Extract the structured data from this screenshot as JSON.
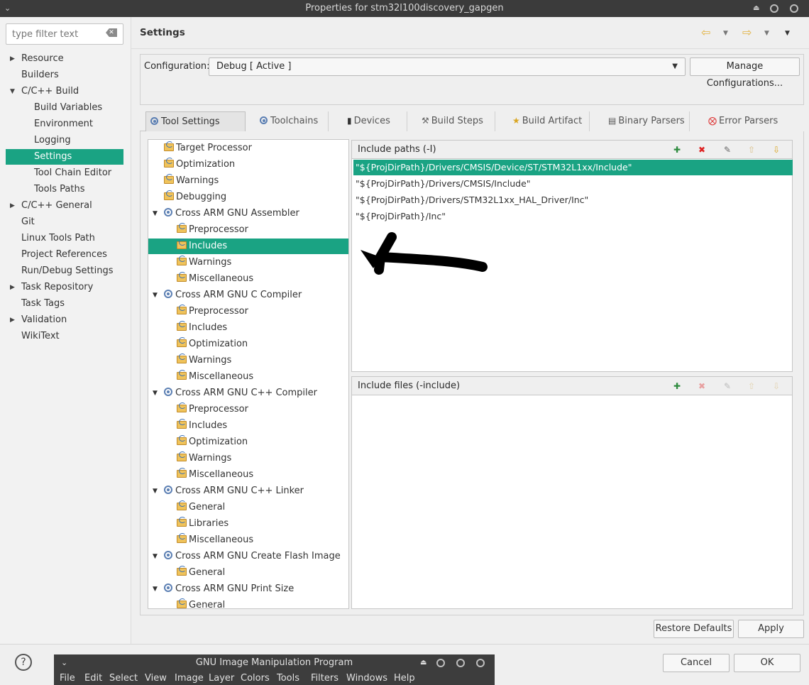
{
  "window": {
    "title": "Properties for stm32l100discovery_gapgen"
  },
  "sidebar": {
    "filter_placeholder": "type filter text",
    "items": [
      {
        "label": "Resource",
        "expander": "collapsed"
      },
      {
        "label": "Builders"
      },
      {
        "label": "C/C++ Build",
        "expander": "expanded"
      },
      {
        "label": "Build Variables",
        "indent": true
      },
      {
        "label": "Environment",
        "indent": true
      },
      {
        "label": "Logging",
        "indent": true
      },
      {
        "label": "Settings",
        "indent": true,
        "selected": true
      },
      {
        "label": "Tool Chain Editor",
        "indent": true
      },
      {
        "label": "Tools Paths",
        "indent": true
      },
      {
        "label": "C/C++ General",
        "expander": "collapsed"
      },
      {
        "label": "Git"
      },
      {
        "label": "Linux Tools Path"
      },
      {
        "label": "Project References"
      },
      {
        "label": "Run/Debug Settings"
      },
      {
        "label": "Task Repository",
        "expander": "collapsed"
      },
      {
        "label": "Task Tags"
      },
      {
        "label": "Validation",
        "expander": "collapsed"
      },
      {
        "label": "WikiText"
      }
    ]
  },
  "header": {
    "title": "Settings"
  },
  "config": {
    "label": "Configuration:",
    "value": "Debug  [ Active ]",
    "manage_label": "Manage Configurations..."
  },
  "tabs": [
    {
      "label": "Tool Settings",
      "active": true
    },
    {
      "label": "Toolchains"
    },
    {
      "label": "Devices"
    },
    {
      "label": "Build Steps"
    },
    {
      "label": "Build Artifact"
    },
    {
      "label": "Binary Parsers"
    },
    {
      "label": "Error Parsers"
    }
  ],
  "tree": [
    {
      "label": "Target Processor",
      "level": 1,
      "icon": "folder-icon"
    },
    {
      "label": "Optimization",
      "level": 1,
      "icon": "folder-icon"
    },
    {
      "label": "Warnings",
      "level": 1,
      "icon": "folder-icon"
    },
    {
      "label": "Debugging",
      "level": 1,
      "icon": "folder-icon"
    },
    {
      "label": "Cross ARM GNU Assembler",
      "level": 1,
      "icon": "gear-icon",
      "expanded": true
    },
    {
      "label": "Preprocessor",
      "level": 2,
      "icon": "folder-icon"
    },
    {
      "label": "Includes",
      "level": 2,
      "icon": "folder-icon",
      "selected": true
    },
    {
      "label": "Warnings",
      "level": 2,
      "icon": "folder-icon"
    },
    {
      "label": "Miscellaneous",
      "level": 2,
      "icon": "folder-icon"
    },
    {
      "label": "Cross ARM GNU C Compiler",
      "level": 1,
      "icon": "gear-icon",
      "expanded": true
    },
    {
      "label": "Preprocessor",
      "level": 2,
      "icon": "folder-icon"
    },
    {
      "label": "Includes",
      "level": 2,
      "icon": "folder-icon"
    },
    {
      "label": "Optimization",
      "level": 2,
      "icon": "folder-icon"
    },
    {
      "label": "Warnings",
      "level": 2,
      "icon": "folder-icon"
    },
    {
      "label": "Miscellaneous",
      "level": 2,
      "icon": "folder-icon"
    },
    {
      "label": "Cross ARM GNU C++ Compiler",
      "level": 1,
      "icon": "gear-icon",
      "expanded": true
    },
    {
      "label": "Preprocessor",
      "level": 2,
      "icon": "folder-icon"
    },
    {
      "label": "Includes",
      "level": 2,
      "icon": "folder-icon"
    },
    {
      "label": "Optimization",
      "level": 2,
      "icon": "folder-icon"
    },
    {
      "label": "Warnings",
      "level": 2,
      "icon": "folder-icon"
    },
    {
      "label": "Miscellaneous",
      "level": 2,
      "icon": "folder-icon"
    },
    {
      "label": "Cross ARM GNU C++ Linker",
      "level": 1,
      "icon": "gear-icon",
      "expanded": true
    },
    {
      "label": "General",
      "level": 2,
      "icon": "folder-icon"
    },
    {
      "label": "Libraries",
      "level": 2,
      "icon": "folder-icon"
    },
    {
      "label": "Miscellaneous",
      "level": 2,
      "icon": "folder-icon"
    },
    {
      "label": "Cross ARM GNU Create Flash Image",
      "level": 1,
      "icon": "gear-icon",
      "expanded": true
    },
    {
      "label": "General",
      "level": 2,
      "icon": "folder-icon"
    },
    {
      "label": "Cross ARM GNU Print Size",
      "level": 1,
      "icon": "gear-icon",
      "expanded": true
    },
    {
      "label": "General",
      "level": 2,
      "icon": "folder-icon"
    }
  ],
  "include_paths": {
    "title": "Include paths (-I)",
    "items": [
      "\"${ProjDirPath}/Drivers/CMSIS/Device/ST/STM32L1xx/Include\"",
      "\"${ProjDirPath}/Drivers/CMSIS/Include\"",
      "\"${ProjDirPath}/Drivers/STM32L1xx_HAL_Driver/Inc\"",
      "\"${ProjDirPath}/Inc\""
    ],
    "selected_index": 0
  },
  "include_files": {
    "title": "Include files (-include)",
    "items": []
  },
  "buttons": {
    "restore_defaults": "Restore Defaults",
    "apply": "Apply",
    "cancel": "Cancel",
    "ok": "OK",
    "help": "?"
  },
  "gimp": {
    "title": "GNU Image Manipulation Program",
    "menu": [
      "File",
      "Edit",
      "Select",
      "View",
      "Image",
      "Layer",
      "Colors",
      "Tools",
      "Filters",
      "Windows",
      "Help"
    ]
  },
  "colors": {
    "selection": "#1aa383",
    "titlebar": "#3b3b3b"
  }
}
